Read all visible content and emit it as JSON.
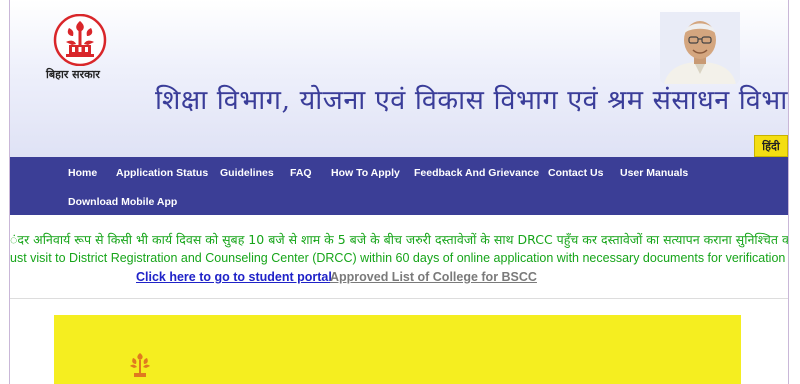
{
  "header": {
    "gov_label": "बिहार सरकार",
    "title": "शिक्षा विभाग, योजना एवं विकास विभाग एवं श्रम संसाधन विभाग",
    "language_toggle": "हिंदी"
  },
  "nav": {
    "items": [
      "Home",
      "Application Status",
      "Guidelines",
      "FAQ",
      "How To Apply",
      "Feedback And Grievance",
      "Contact Us",
      "User Manuals",
      "Download Mobile App"
    ]
  },
  "notice": {
    "hindi": "ंदर अनिवार्य रूप से किसी भी कार्य दिवस को सुबह 10 बजे से शाम के 5 बजे के बीच जरुरी दस्तावेजों के साथ DRCC पहुँच कर दस्तावेजों का सत्यापन कराना सुनिश्चित करें ।",
    "english": "ust visit to District Registration and Counseling Center (DRCC) within 60 days of online application with necessary documents for verification on any work"
  },
  "links": {
    "student_portal": "Click here to go to student portal",
    "approved_list": "Approved List of College for BSCC"
  },
  "colors": {
    "nav_bg": "#3b3e96",
    "title": "#3a3d99",
    "notice": "#17a51a",
    "link": "#1f22c8",
    "panel": "#f5ee20",
    "emblem": "#d9262a"
  },
  "icons": {
    "emblem": "bihar-emblem-icon",
    "photo": "chief-minister-photo"
  }
}
